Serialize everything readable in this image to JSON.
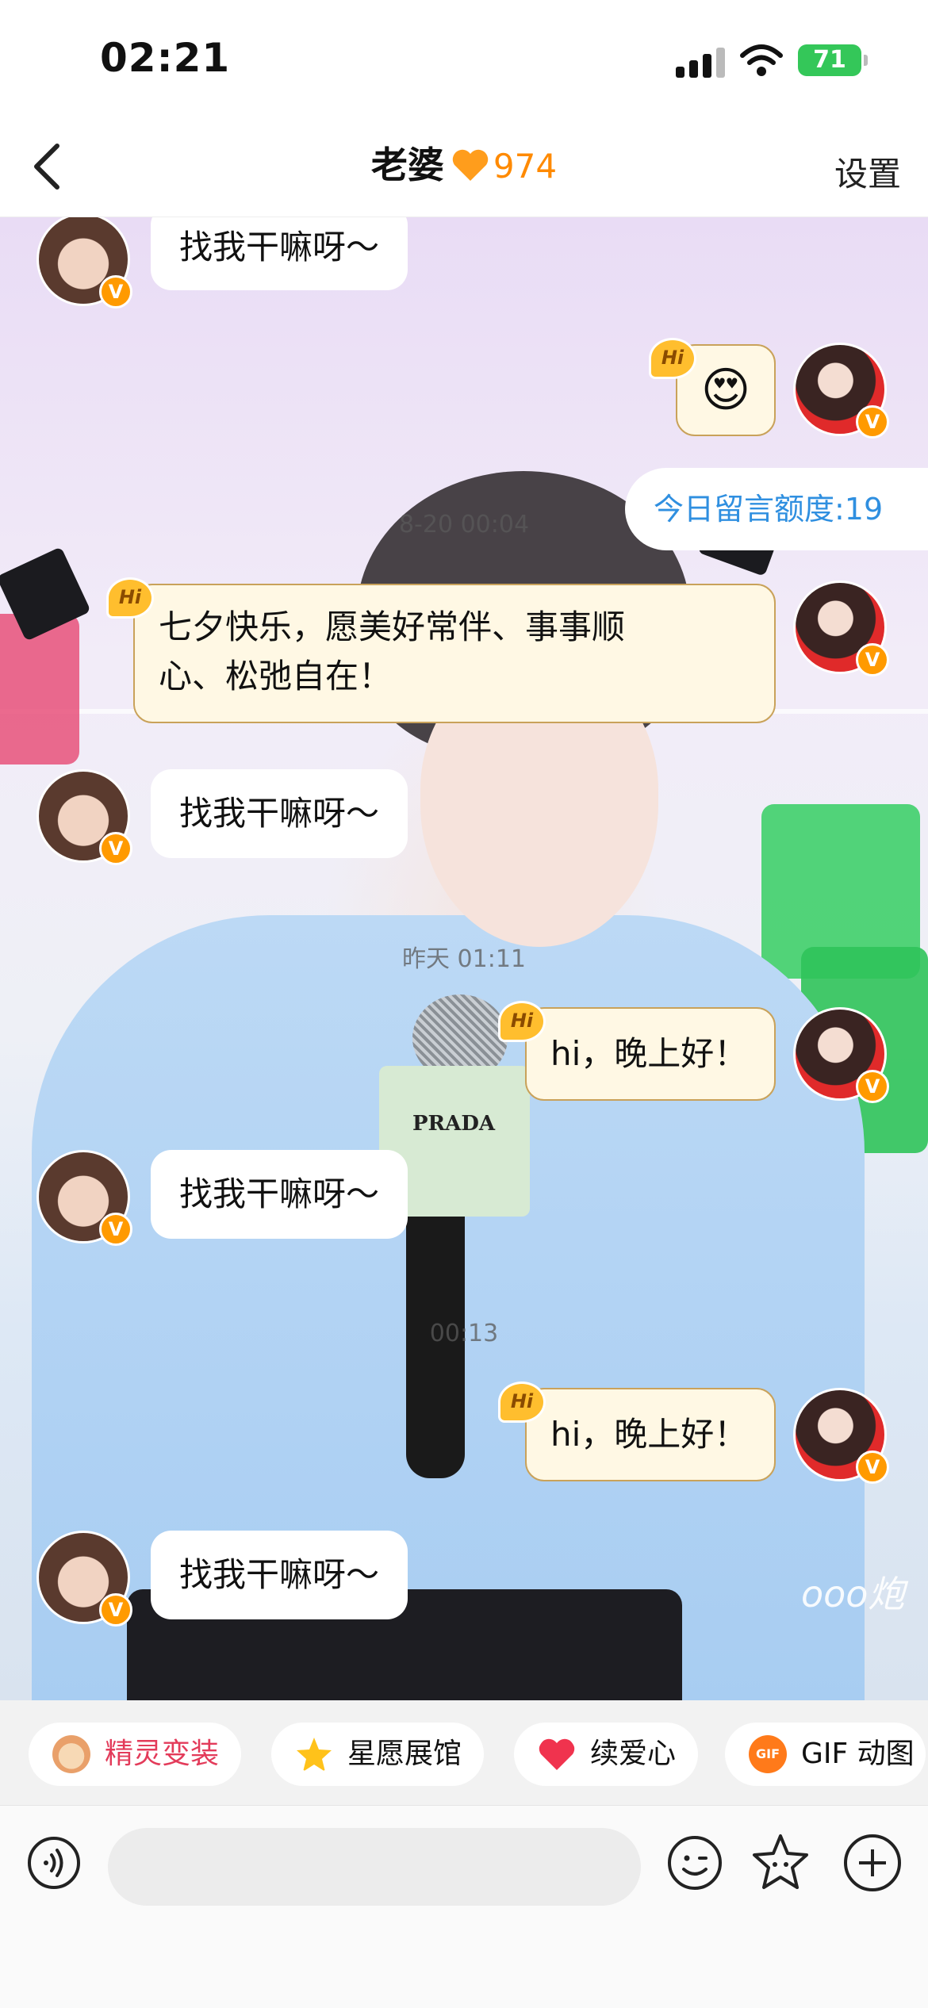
{
  "status_bar": {
    "time": "02:21",
    "battery": "71"
  },
  "nav": {
    "title": "老婆",
    "heart_score": "974",
    "settings": "设置"
  },
  "quota": "今日留言额度:19",
  "timestamps": [
    "8-20 00:04",
    "昨天 01:11",
    "00:13"
  ],
  "messages": {
    "girl_top": "找我干嘛呀～",
    "greeting_long": "七夕快乐，愿美好常伴、事事顺心、松弛自在！",
    "greeting_long_line1": "七夕快乐，愿美好常伴、事事顺",
    "greeting_long_line2": "心、松弛自在！",
    "girl_2": "找我干嘛呀～",
    "hi_1": "hi，晚上好！",
    "girl_3": "找我干嘛呀～",
    "hi_2": "hi，晚上好！",
    "girl_4": "找我干嘛呀～",
    "emoji_sticker": "😍"
  },
  "hi_badge": "Hi",
  "verified_badge": "V",
  "background_text": {
    "prada": "PRADA",
    "watermark": "ooo炮"
  },
  "quick_actions": [
    {
      "label": "精灵变装",
      "icon": "monkey-icon",
      "color": "#e33b5a"
    },
    {
      "label": "星愿展馆",
      "icon": "star-icon",
      "color": "#222222"
    },
    {
      "label": "续爱心",
      "icon": "heart-icon",
      "color": "#222222"
    },
    {
      "label": "GIF 动图",
      "icon": "gif-icon",
      "color": "#222222"
    }
  ],
  "input": {
    "placeholder": ""
  },
  "colors": {
    "accent": "#ff8a00",
    "quota_blue": "#2f8fe0",
    "chip_red": "#e33b5a"
  }
}
